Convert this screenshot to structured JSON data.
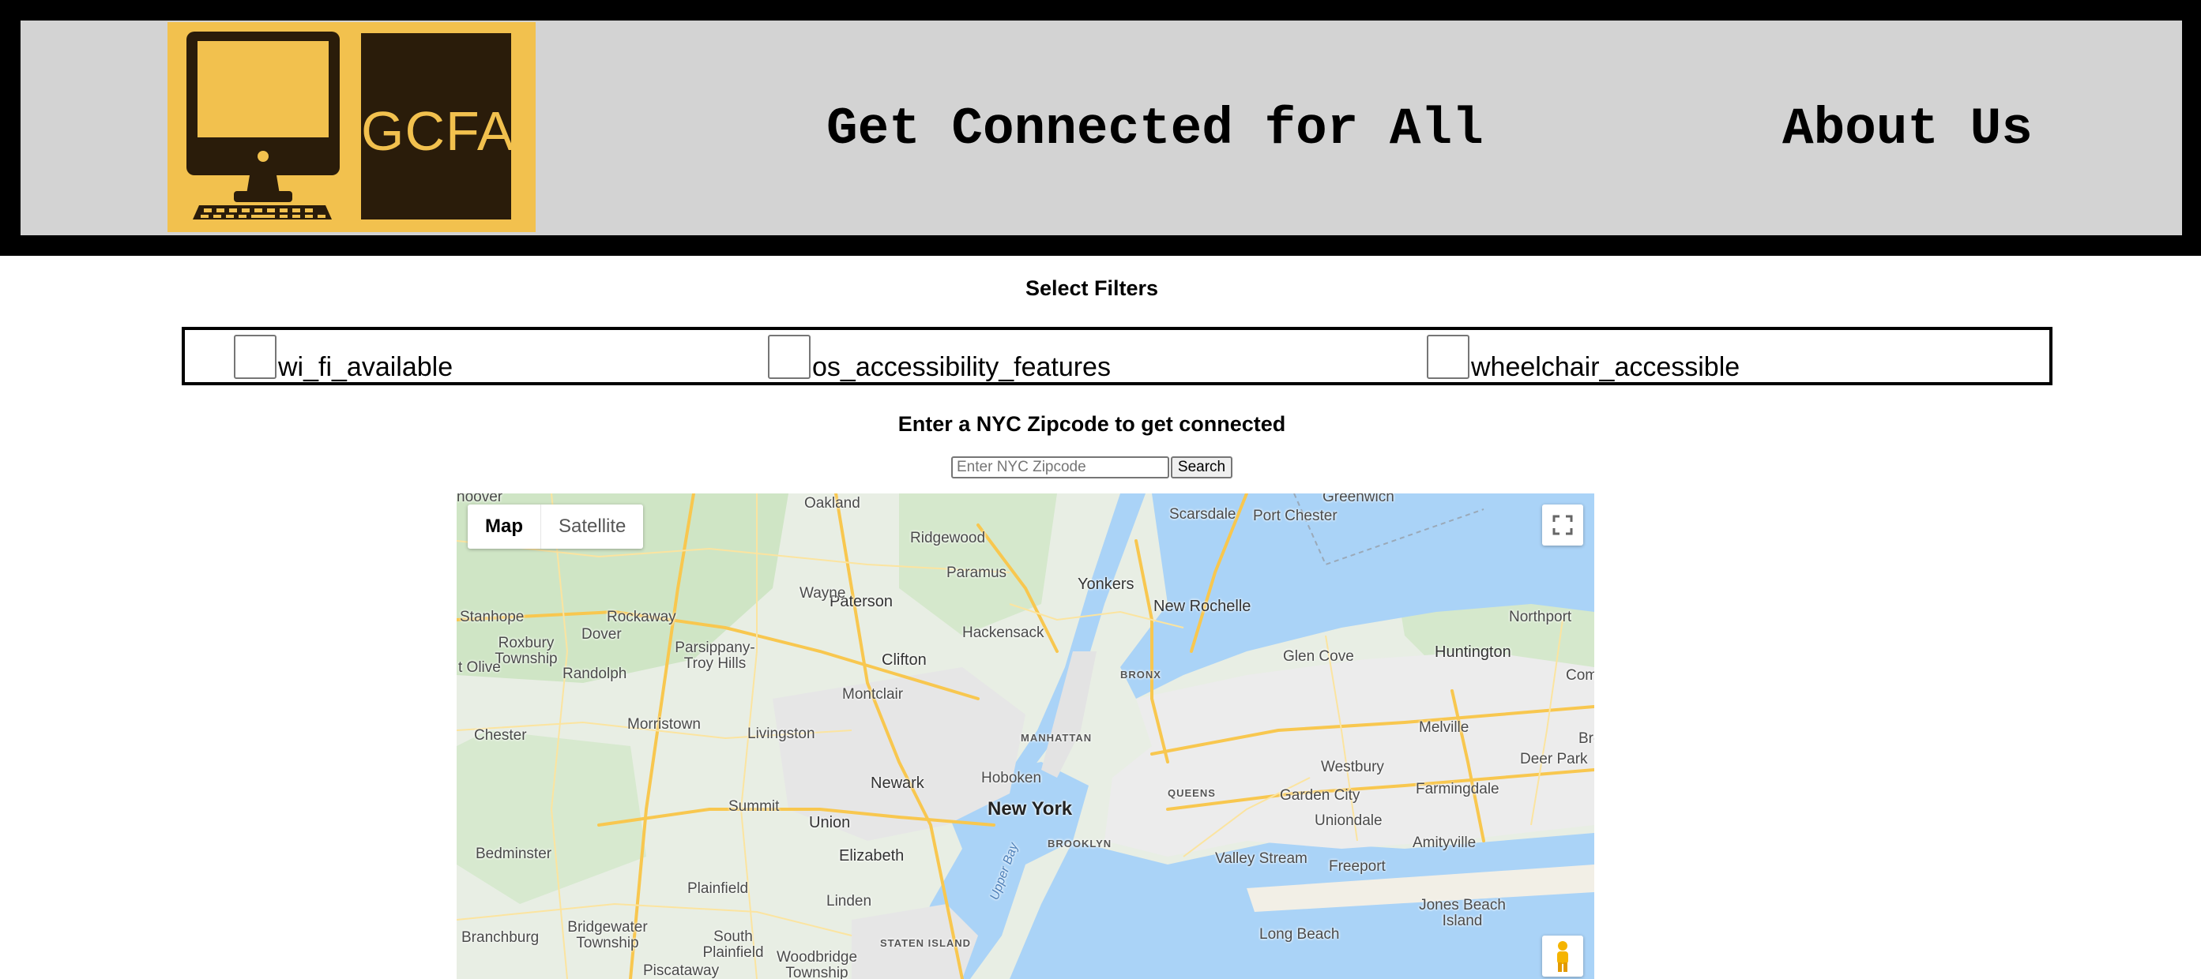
{
  "header": {
    "logo_text": "GCFA",
    "site_title": "Get Connected for All",
    "about_link": "About Us"
  },
  "filters": {
    "heading": "Select Filters",
    "options": [
      {
        "label": "wi_fi_available",
        "checked": false
      },
      {
        "label": "os_accessibility_features",
        "checked": false
      },
      {
        "label": "wheelchair_accessible",
        "checked": false
      }
    ]
  },
  "zip_search": {
    "heading": "Enter a NYC Zipcode to get connected",
    "placeholder": "Enter NYC Zipcode",
    "value": "",
    "button_label": "Search"
  },
  "map": {
    "type_controls": {
      "map": "Map",
      "satellite": "Satellite",
      "selected": "Map"
    },
    "fullscreen_icon": "fullscreen-icon",
    "pegman_icon": "street-view-pegman-icon",
    "places": {
      "new_york": "New York",
      "newark": "Newark",
      "yonkers": "Yonkers",
      "new_rochelle": "New Rochelle",
      "paterson": "Paterson",
      "clifton": "Clifton",
      "hackensack": "Hackensack",
      "hoboken": "Hoboken",
      "manhattan": "MANHATTAN",
      "brooklyn": "BROOKLYN",
      "queens": "QUEENS",
      "bronx": "BRONX",
      "staten_island": "STATEN ISLAND",
      "elizabeth": "Elizabeth",
      "union": "Union",
      "summit": "Summit",
      "livingston": "Livingston",
      "montclair": "Montclair",
      "morristown": "Morristown",
      "randolph": "Randolph",
      "dover": "Dover",
      "rockaway": "Rockaway",
      "wayne": "Wayne",
      "paramus": "Paramus",
      "ridgewood": "Ridgewood",
      "oakland": "Oakland",
      "scarsdale": "Scarsdale",
      "port_chester": "Port Chester",
      "glen_cove": "Glen Cove",
      "huntington": "Huntington",
      "northport": "Northport",
      "melville": "Melville",
      "deer_park": "Deer Park",
      "farmingdale": "Farmingdale",
      "amityville": "Amityville",
      "westbury": "Westbury",
      "garden_city": "Garden City",
      "uniondale": "Uniondale",
      "freeport": "Freeport",
      "valley_stream": "Valley Stream",
      "long_beach": "Long Beach",
      "jones_beach_island": "Jones Beach Island",
      "plainfield": "Plainfield",
      "linden": "Linden",
      "bedminster": "Bedminster",
      "chester": "Chester",
      "stanhope": "Stanhope",
      "roxbury_township": "Roxbury Township",
      "mt_olive": "t Olive",
      "parsippany": "Parsippany-Troy Hills",
      "bridgewater": "Bridgewater Township",
      "branchburg": "Branchburg",
      "south_plainfield": "South Plainfield",
      "woodbridge": "Woodbridge Township",
      "piscataway": "Piscataway",
      "upper_bay": "Upper Bay",
      "commack": "Commac",
      "brentwood": "Bre",
      "hoover": "hoover",
      "greenwich": "Greenwich"
    }
  }
}
